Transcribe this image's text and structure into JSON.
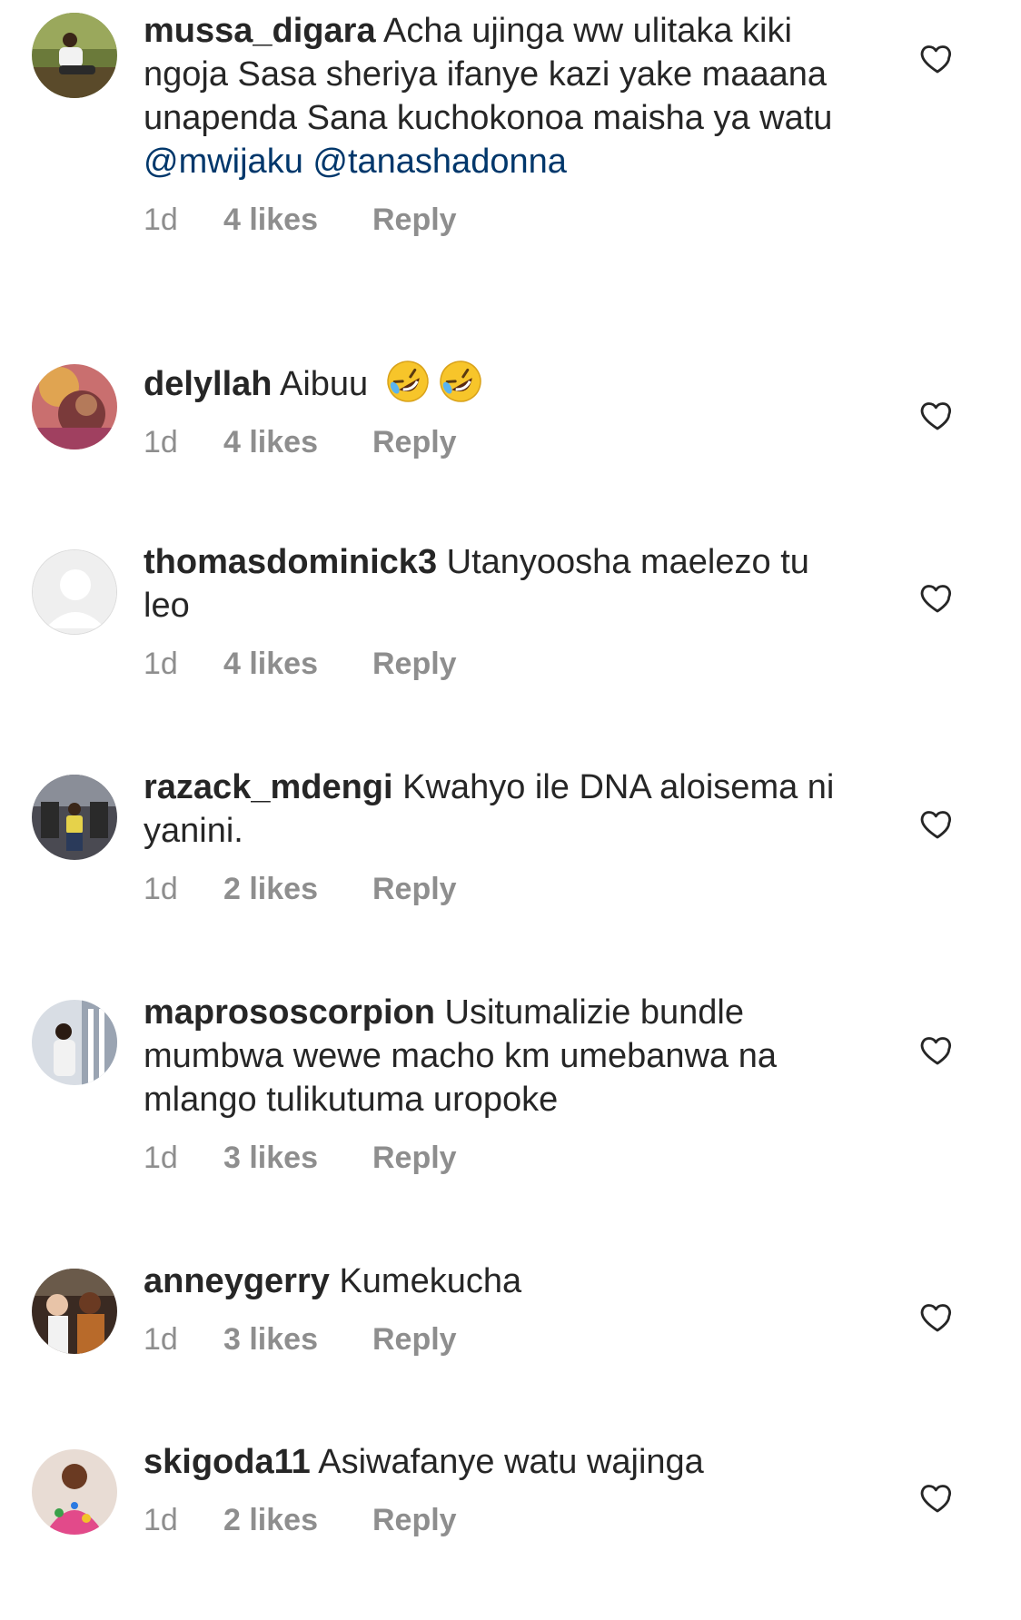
{
  "comments": [
    {
      "username": "mussa_digara",
      "text": "Acha ujinga ww ulitaka kiki ngoja Sasa sheriya ifanye kazi yake maaana unapenda Sana kuchokonoa maisha ya watu",
      "mentions": [
        "@mwijaku",
        "@tanashadonna"
      ],
      "time": "1d",
      "likes": "4 likes",
      "reply": "Reply",
      "avatar": "photo"
    },
    {
      "username": "delyllah",
      "text": "Aibuu",
      "emojis": [
        "rolling-on-floor-laughing",
        "rolling-on-floor-laughing"
      ],
      "time": "1d",
      "likes": "4 likes",
      "reply": "Reply",
      "avatar": "photo"
    },
    {
      "username": "thomasdominick3",
      "text": "Utanyoosha maelezo tu leo",
      "time": "1d",
      "likes": "4 likes",
      "reply": "Reply",
      "avatar": "default-profile"
    },
    {
      "username": "razack_mdengi",
      "text": "Kwahyo ile DNA aloisema ni yanini.",
      "time": "1d",
      "likes": "2 likes",
      "reply": "Reply",
      "avatar": "photo"
    },
    {
      "username": "maprososcorpion",
      "text": "Usitumalizie bundle mumbwa wewe macho km umebanwa na mlango tulikutuma uropoke",
      "time": "1d",
      "likes": "3 likes",
      "reply": "Reply",
      "avatar": "photo"
    },
    {
      "username": "anneygerry",
      "text": "Kumekucha",
      "time": "1d",
      "likes": "3 likes",
      "reply": "Reply",
      "avatar": "photo"
    },
    {
      "username": "skigoda11",
      "text": "Asiwafanye watu wajinga",
      "time": "1d",
      "likes": "2 likes",
      "reply": "Reply",
      "avatar": "photo"
    }
  ],
  "colors": {
    "text": "#262626",
    "secondary": "#8e8e8e",
    "mention": "#00376b",
    "background": "#ffffff"
  },
  "icons": {
    "like": "heart-outline-icon"
  }
}
